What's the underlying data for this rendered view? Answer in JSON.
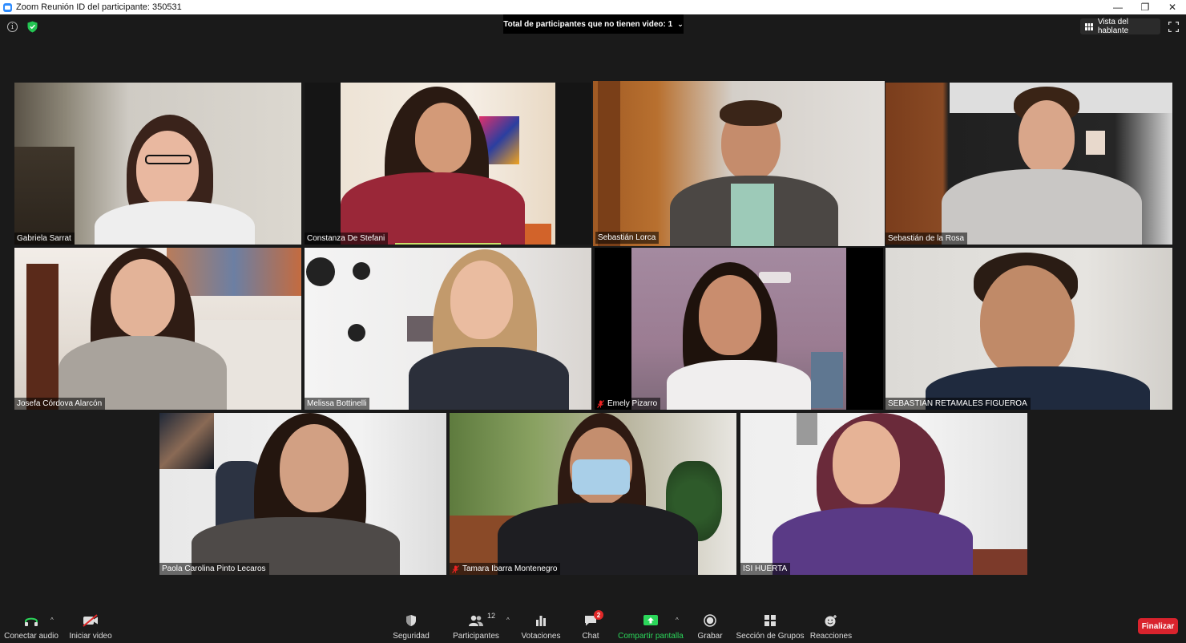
{
  "window": {
    "title": "Zoom Reunión ID del participante: 350531"
  },
  "topbar": {
    "banner_text": "Total de participantes que no tienen video: 1",
    "view_button": "Vista del hablante"
  },
  "participants": [
    {
      "name": "Gabriela Sarrat",
      "muted": false
    },
    {
      "name": "Constanza De Stefani",
      "muted": false
    },
    {
      "name": "Sebastián Lorca",
      "muted": false,
      "active_speaker": true
    },
    {
      "name": "Sebastián de la Rosa",
      "muted": false
    },
    {
      "name": "Josefa Córdova Alarcón",
      "muted": false
    },
    {
      "name": "Melissa Bottinelli",
      "muted": false
    },
    {
      "name": "Emely Pizarro",
      "muted": true
    },
    {
      "name": "SEBASTIAN RETAMALES FIGUEROA",
      "muted": false
    },
    {
      "name": "Paola Carolina Pinto Lecaros",
      "muted": false
    },
    {
      "name": "Tamara Ibarra Montenegro",
      "muted": true
    },
    {
      "name": "ISI HUERTA",
      "muted": false
    }
  ],
  "toolbar": {
    "audio": "Conectar audio",
    "video": "Iniciar video",
    "security": "Seguridad",
    "participants": "Participantes",
    "participants_count": "12",
    "polls": "Votaciones",
    "chat": "Chat",
    "chat_badge": "2",
    "share": "Compartir pantalla",
    "record": "Grabar",
    "breakout": "Sección de Grupos",
    "reactions": "Reacciones",
    "end": "Finalizar"
  },
  "colors": {
    "active_speaker_border": "#c9e06a",
    "share_green": "#2bd65a",
    "end_red": "#d9232d",
    "chat_badge_red": "#e02828"
  }
}
